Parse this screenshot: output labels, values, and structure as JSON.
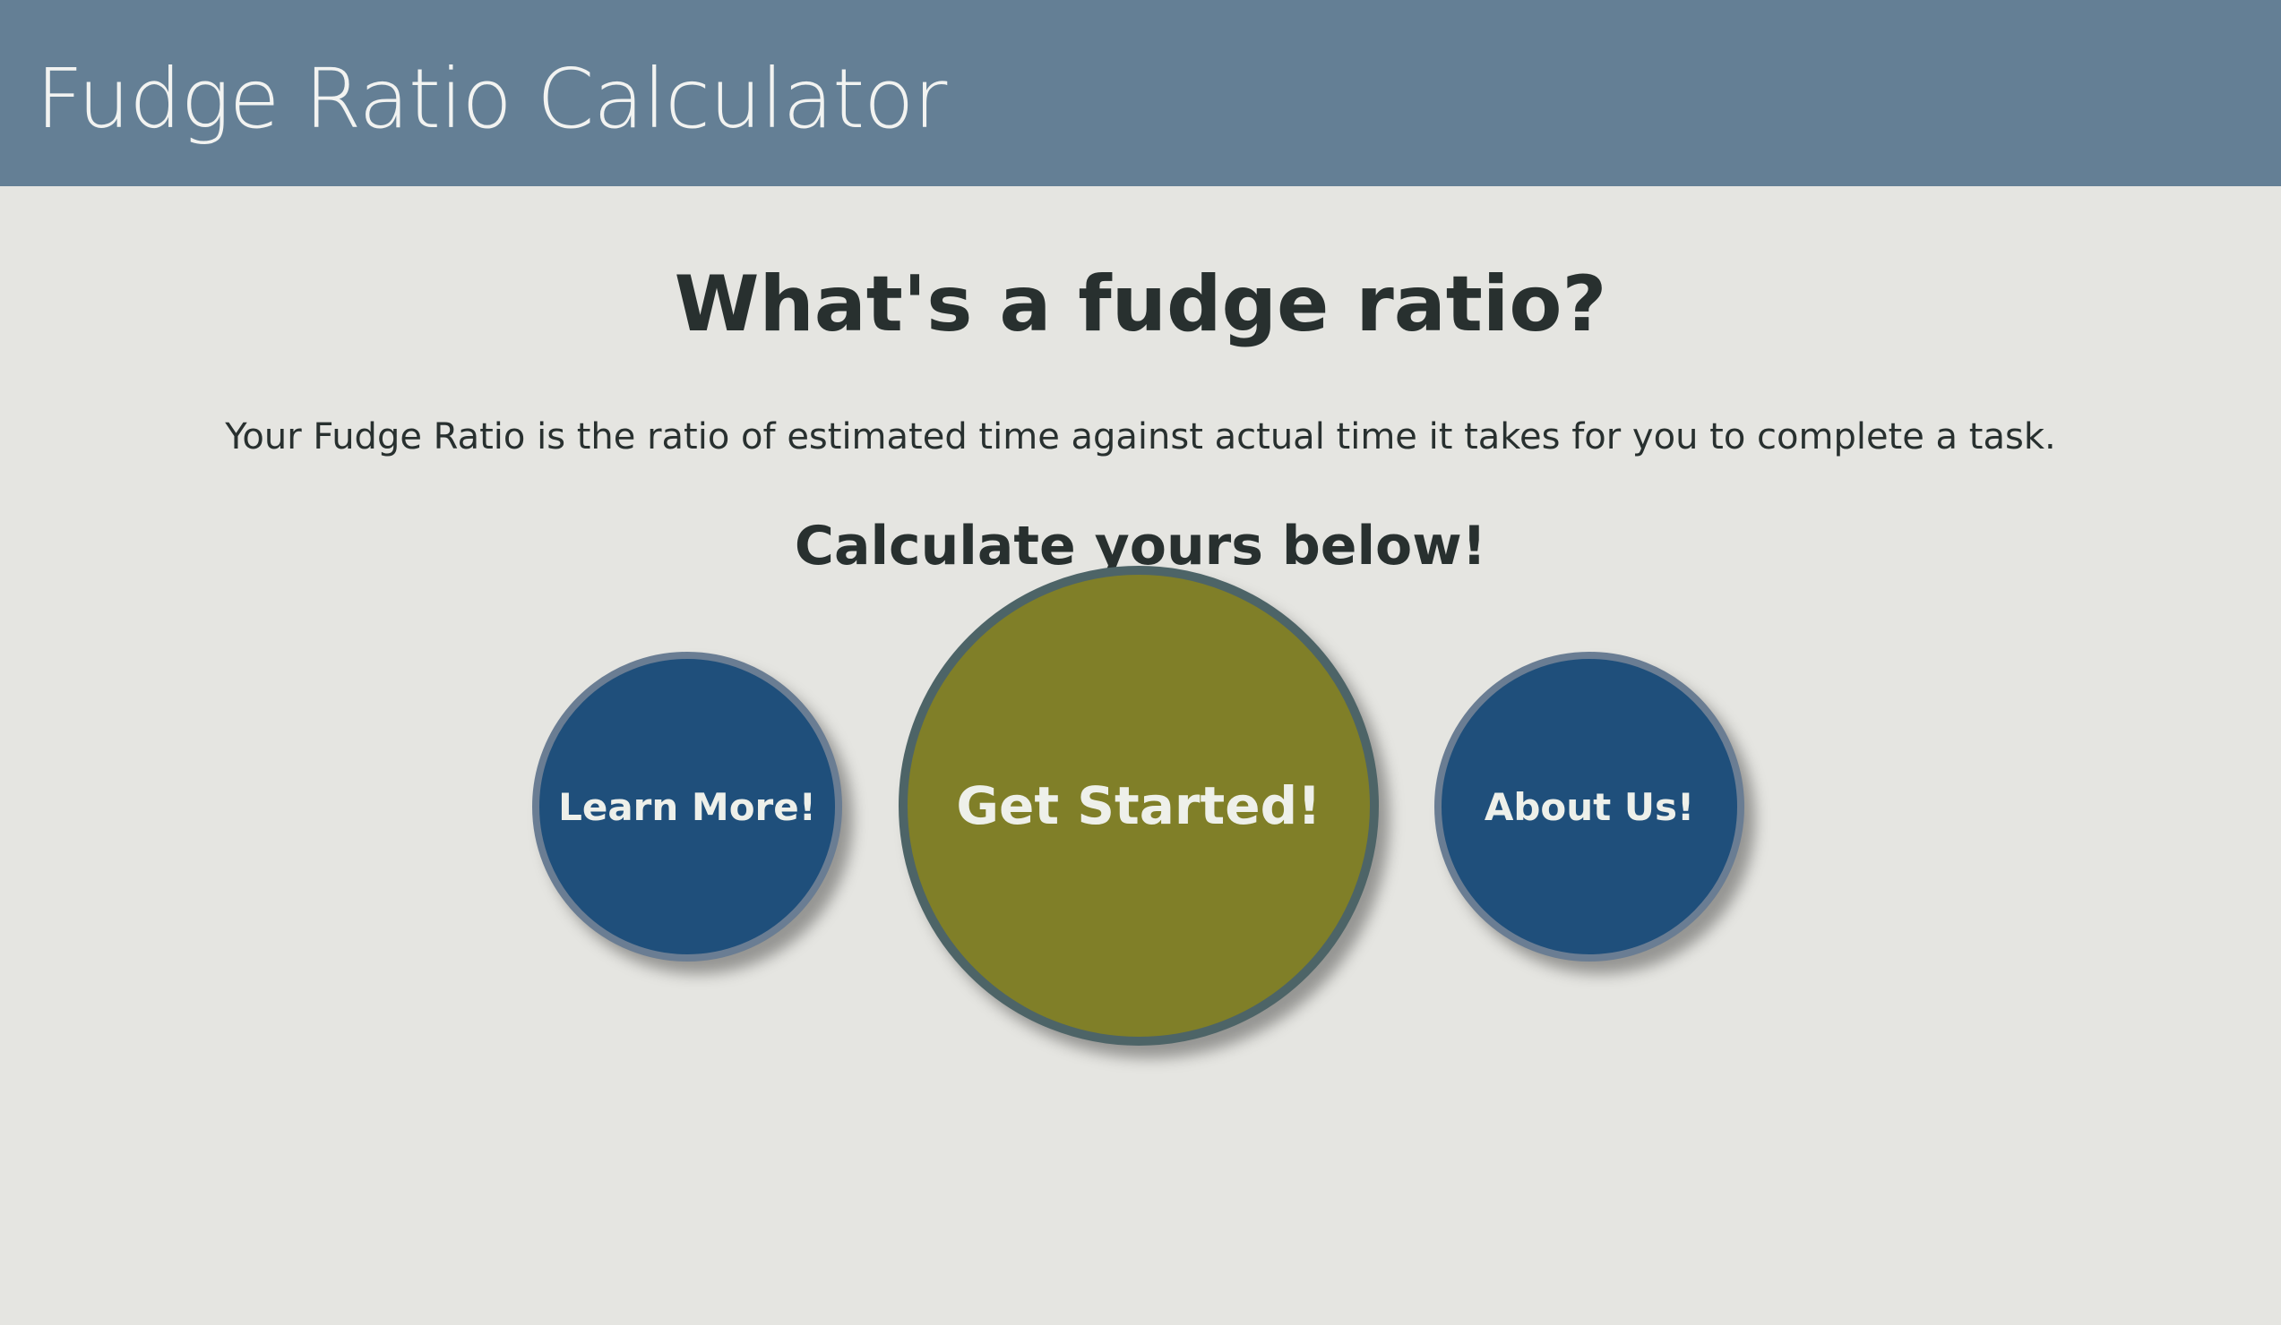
{
  "header": {
    "title": "Fudge Ratio Calculator"
  },
  "main": {
    "heading": "What's a fudge ratio?",
    "description": "Your Fudge Ratio is the ratio of estimated time against actual time it takes for you to complete a task.",
    "subheading": "Calculate yours below!"
  },
  "buttons": {
    "learn_more": "Learn More!",
    "get_started": "Get Started!",
    "about_us": "About Us!"
  },
  "colors": {
    "header_bg": "#647f95",
    "page_bg": "#e5e5e1",
    "text": "#28302f",
    "blue_button": "#1f4f7b",
    "olive_button": "#807f28"
  }
}
